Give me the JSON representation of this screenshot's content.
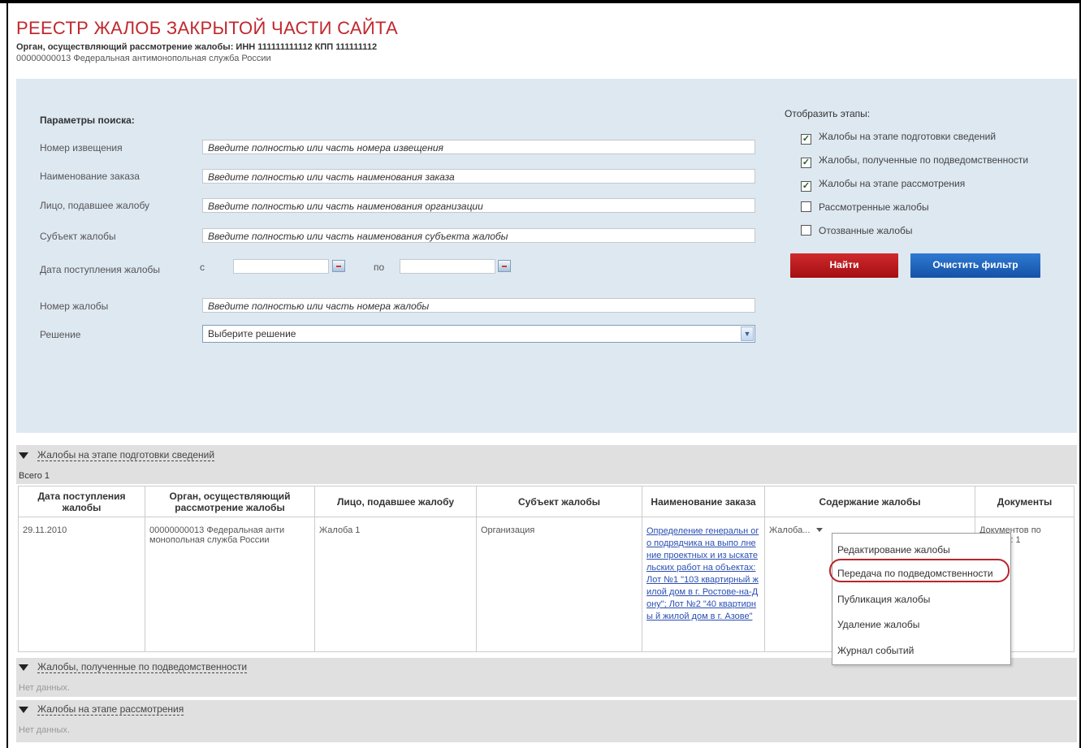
{
  "header": {
    "title": "РЕЕСТР ЖАЛОБ ЗАКРЫТОЙ ЧАСТИ САЙТА",
    "subtitle": "Орган, осуществляющий рассмотрение жалобы: ИНН 111111111112 КПП 111111112",
    "org_line": "00000000013 Федеральная антимонопольная служба России"
  },
  "search": {
    "section_title": "Параметры поиска:",
    "fields": [
      {
        "label": "Номер извещения",
        "placeholder": "Введите полностью или часть номера извещения"
      },
      {
        "label": "Наименование заказа",
        "placeholder": "Введите полностью или часть наименования заказа"
      },
      {
        "label": "Лицо, подавшее жалобу",
        "placeholder": "Введите полностью или часть наименования организации"
      },
      {
        "label": "Субъект жалобы",
        "placeholder": "Введите полностью или часть наименования субъекта жалобы"
      }
    ],
    "date_label": "Дата поступления жалобы",
    "date_from_label": "с",
    "date_to_label": "по",
    "complaint_no_label": "Номер жалобы",
    "complaint_no_placeholder": "Введите полностью или часть номера жалобы",
    "decision_label": "Решение",
    "decision_value": "Выберите решение"
  },
  "stages": {
    "title": "Отобразить этапы:",
    "items": [
      {
        "label": "Жалобы на этапе подготовки сведений",
        "checked": true,
        "mark": "✓"
      },
      {
        "label": "Жалобы, полученные по подведомственности",
        "checked": true,
        "mark": "✓"
      },
      {
        "label": "Жалобы на этапе рассмотрения",
        "checked": true,
        "mark": "✓"
      },
      {
        "label": "Рассмотренные жалобы",
        "checked": false,
        "mark": ""
      },
      {
        "label": "Отозванные жалобы",
        "checked": false,
        "mark": ""
      }
    ]
  },
  "buttons": {
    "find": "Найти",
    "clear": "Очистить фильтр"
  },
  "groups": {
    "prep": {
      "title": "Жалобы на этапе подготовки сведений",
      "count": "Всего 1"
    },
    "received": {
      "title": "Жалобы, полученные по подведомственности",
      "empty": "Нет данных."
    },
    "review": {
      "title": "Жалобы на этапе рассмотрения",
      "empty": "Нет данных."
    }
  },
  "table": {
    "headers": [
      "Дата поступления жалобы",
      "Орган, осуществляющий рассмотрение жалобы",
      "Лицо, подавшее жалобу",
      "Субъект жалобы",
      "Наименование заказа",
      "Содержание жалобы",
      "Документы"
    ],
    "row": {
      "date": "29.11.2010",
      "organ": "00000000013 Федеральная анти монопольная служба России",
      "person": "Жалоба 1",
      "subject": "Организация",
      "order": "Определение генеральн ого подрядчика на выпо лнение проектных и из ыскательских работ на объектах: Лот №1 \"103 квартирный жилой дом в г. Ростове-на-Дону\"; Лот №2 \"40 квартирны й жилой дом в г. Азове\"",
      "content": "Жалоба...",
      "docs": "Документов по жалобе: 1"
    }
  },
  "context_menu": {
    "items": [
      "Редактирование жалобы",
      "Передача по подведомственности",
      "Публикация жалобы",
      "Удаление жалобы",
      "Журнал событий"
    ]
  }
}
